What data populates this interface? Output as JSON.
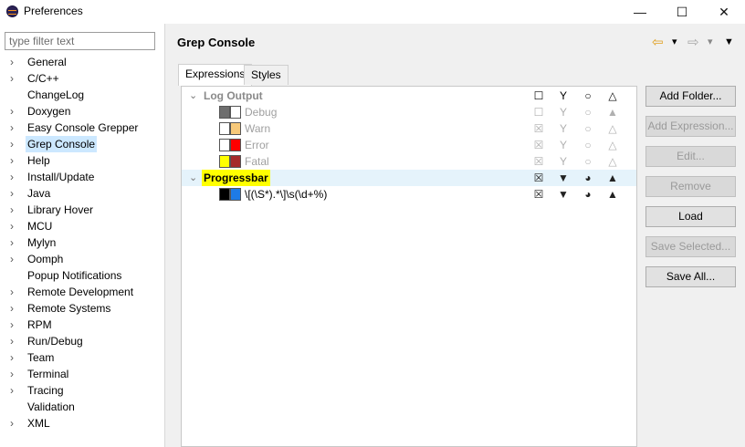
{
  "window": {
    "title": "Preferences",
    "minimize": "—",
    "maximize": "☐",
    "close": "✕"
  },
  "filter": {
    "placeholder": "type filter text"
  },
  "tree": [
    {
      "label": "General",
      "expandable": true
    },
    {
      "label": "C/C++",
      "expandable": true
    },
    {
      "label": "ChangeLog",
      "expandable": false
    },
    {
      "label": "Doxygen",
      "expandable": true
    },
    {
      "label": "Easy Console Grepper",
      "expandable": true
    },
    {
      "label": "Grep Console",
      "expandable": true,
      "selected": true
    },
    {
      "label": "Help",
      "expandable": true
    },
    {
      "label": "Install/Update",
      "expandable": true
    },
    {
      "label": "Java",
      "expandable": true
    },
    {
      "label": "Library Hover",
      "expandable": true
    },
    {
      "label": "MCU",
      "expandable": true
    },
    {
      "label": "Mylyn",
      "expandable": true
    },
    {
      "label": "Oomph",
      "expandable": true
    },
    {
      "label": "Popup Notifications",
      "expandable": false
    },
    {
      "label": "Remote Development",
      "expandable": true
    },
    {
      "label": "Remote Systems",
      "expandable": true
    },
    {
      "label": "RPM",
      "expandable": true
    },
    {
      "label": "Run/Debug",
      "expandable": true
    },
    {
      "label": "Team",
      "expandable": true
    },
    {
      "label": "Terminal",
      "expandable": true
    },
    {
      "label": "Tracing",
      "expandable": true
    },
    {
      "label": "Validation",
      "expandable": false
    },
    {
      "label": "XML",
      "expandable": true
    }
  ],
  "page": {
    "title": "Grep Console",
    "back_icon": "⇦",
    "forward_icon": "⇨",
    "dropdown_icon": "▾",
    "menu_icon": "▼"
  },
  "tabs": [
    "Expressions",
    "Styles"
  ],
  "expressions": {
    "groups": [
      {
        "name": "Log Output",
        "enabled": false,
        "icons": [
          "☐",
          "Y",
          "○",
          "△"
        ],
        "items": [
          {
            "name": "Debug",
            "colors": [
              "#6e6e6e",
              "#ffffff"
            ],
            "icons": [
              "☐",
              "Y",
              "○",
              "▲"
            ]
          },
          {
            "name": "Warn",
            "colors": [
              "#ffffff",
              "#f7c97a"
            ],
            "icons": [
              "☒",
              "Y",
              "○",
              "△"
            ]
          },
          {
            "name": "Error",
            "colors": [
              "#ffffff",
              "#ff0000"
            ],
            "icons": [
              "☒",
              "Y",
              "○",
              "△"
            ]
          },
          {
            "name": "Fatal",
            "colors": [
              "#ffff00",
              "#a52a2a"
            ],
            "icons": [
              "☒",
              "Y",
              "○",
              "△"
            ]
          }
        ]
      },
      {
        "name": "Progressbar",
        "enabled": true,
        "icons": [
          "☒",
          "▼",
          "◕",
          "▲"
        ],
        "items": [
          {
            "name": "\\[(\\S*).*\\]\\s(\\d+%)",
            "colors": [
              "#000000",
              "#1e7be6"
            ],
            "icons": [
              "☒",
              "▼",
              "◕",
              "▲"
            ]
          }
        ]
      }
    ]
  },
  "buttons": {
    "add_folder": "Add Folder...",
    "add_expression": "Add Expression...",
    "edit": "Edit...",
    "remove": "Remove",
    "load": "Load",
    "save_selected": "Save Selected...",
    "save_all": "Save All..."
  }
}
